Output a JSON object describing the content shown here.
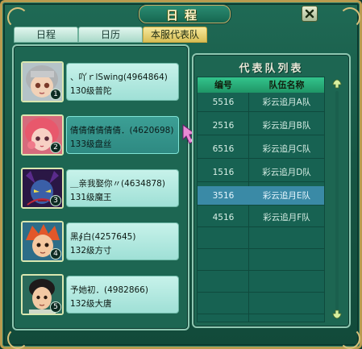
{
  "window": {
    "title": "日程"
  },
  "tabs": [
    {
      "label": "日程"
    },
    {
      "label": "日历"
    },
    {
      "label": "本服代表队"
    }
  ],
  "members": [
    {
      "name": "、吖ｒlSwing(4964864)",
      "level": "130级普陀",
      "slot": "1",
      "avatar_colors": {
        "bg": "#b5c3c8",
        "hair": "#aeb2b4",
        "face": "#f2d2b8"
      }
    },
    {
      "name": "倩倩倩倩倩倩．(4620698)",
      "level": "133级盘丝",
      "slot": "2",
      "avatar_colors": {
        "bg": "#d66b7c",
        "hair": "#e8586c",
        "face": "#f7d0c4"
      }
    },
    {
      "name": "＿亲我娶你〃(4634878)",
      "level": "131级魔王",
      "slot": "3",
      "avatar_colors": {
        "bg": "#2a1745",
        "hair": "#5a2b8c",
        "face": "#3a5fa8"
      }
    },
    {
      "name": "黑∮白(4257645)",
      "level": "132级方寸",
      "slot": "4",
      "avatar_colors": {
        "bg": "#2d6d88",
        "hair": "#e2572a",
        "face": "#f4c8a0"
      }
    },
    {
      "name": "予她初．(4982866)",
      "level": "132级大唐",
      "slot": "5",
      "avatar_colors": {
        "bg": "#2a6a5a",
        "hair": "#1e1a1a",
        "face": "#f2c9a4"
      }
    }
  ],
  "team_list": {
    "title": "代表队列表",
    "headers": {
      "id": "编号",
      "name": "队伍名称"
    },
    "rows": [
      {
        "id": "5516",
        "name": "彩云追月A队"
      },
      {
        "id": "2516",
        "name": "彩云追月B队"
      },
      {
        "id": "6516",
        "name": "彩云追月C队"
      },
      {
        "id": "1516",
        "name": "彩云追月D队"
      },
      {
        "id": "3516",
        "name": "彩云追月E队"
      },
      {
        "id": "4516",
        "name": "彩云追月F队"
      }
    ],
    "selected_index": 4,
    "empty_rows": 5
  },
  "colors": {
    "frame": "#b99b4f",
    "panel": "#1d6652",
    "header": "#33c48c",
    "selected_row": "#3a8aa6",
    "active_tab": "#d8bf56"
  }
}
